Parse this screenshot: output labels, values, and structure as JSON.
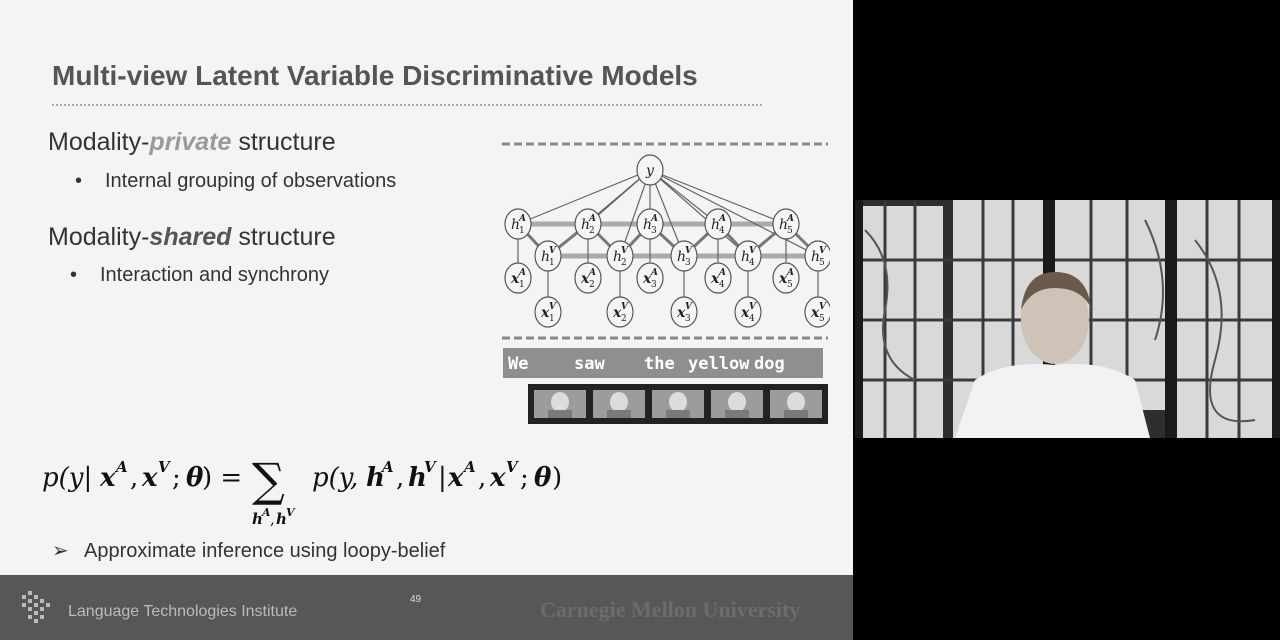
{
  "slide": {
    "title": "Multi-view Latent Variable Discriminative Models",
    "sections": [
      {
        "prefix": "Modality-",
        "emphasis": "private",
        "suffix": " structure",
        "bullet": "Internal grouping of observations"
      },
      {
        "prefix": "Modality-",
        "emphasis": "shared",
        "suffix": " structure",
        "bullet": "Interaction and synchrony"
      }
    ],
    "bullet_glyph": "•",
    "inference_arrow": "➢",
    "inference_text": "Approximate inference using loopy-belief",
    "diagram": {
      "root": "y",
      "words": [
        "We",
        "saw",
        "the",
        "yellow",
        "dog"
      ]
    },
    "formula": {
      "lhs": "p(y | x",
      "sup_a": "A",
      "sup_v": "V",
      "theta": "θ",
      "sum_symbol": "∑"
    },
    "colors": {
      "private_emphasis": "#9a9a9a",
      "shared_emphasis": "#555555",
      "footer_bg": "#575757"
    }
  },
  "footer": {
    "institute": "Language Technologies Institute",
    "page_number": "49",
    "university": "Carnegie Mellon University"
  },
  "webcam": {
    "label": "presenter-video"
  }
}
